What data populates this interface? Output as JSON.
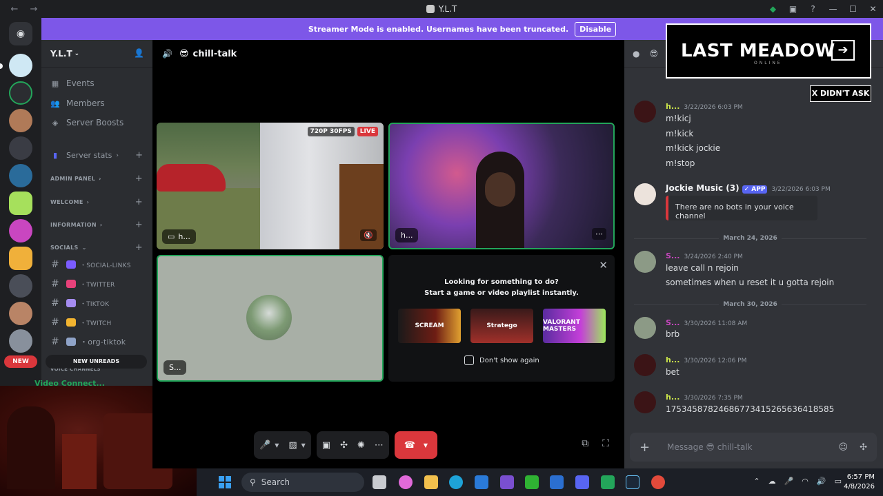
{
  "window": {
    "title": "Y.L.T",
    "back": "←",
    "forward": "→"
  },
  "banner": {
    "text": "Streamer Mode is enabled. Usernames have been truncated.",
    "disable_label": "Disable"
  },
  "server": {
    "name": "Y.L.T",
    "nav": [
      {
        "icon": "calendar-icon",
        "label": "Events"
      },
      {
        "icon": "members-icon",
        "label": "Members"
      },
      {
        "icon": "boost-icon",
        "label": "Server Boosts"
      }
    ],
    "server_stats": "Server stats",
    "categories": [
      {
        "label": "ADMIN PANEL"
      },
      {
        "label": "WELCOME"
      },
      {
        "label": "INFORMATION"
      },
      {
        "label": "SOCIALS"
      }
    ],
    "channels": [
      {
        "label": "・SOCIAL-LINKS",
        "color": "#7b5cff"
      },
      {
        "label": "・TWITTER",
        "color": "#e7417a"
      },
      {
        "label": "・TIKTOK",
        "color": "#a58cf0"
      },
      {
        "label": "・TWITCH",
        "color": "#f2b430"
      },
      {
        "label": "・org-tiktok",
        "color": "#8fa3c8"
      }
    ],
    "new_unreads": "NEW UNREADS",
    "voice_channels": "VOICE CHANNELS",
    "new_badge": "NEW",
    "video_connected": "Video Connect..."
  },
  "stage": {
    "channel_name": "chill-talk",
    "channel_emoji": "😎",
    "tiles": [
      {
        "label": "h...",
        "quality": "720P 30FPS",
        "live": "LIVE"
      },
      {
        "label": "h..."
      },
      {
        "label": "S..."
      }
    ],
    "activity": {
      "title": "Looking for something to do?",
      "subtitle": "Start a game or video playlist instantly.",
      "games": [
        "SCREAM",
        "Stratego",
        "VALORANT MASTERS"
      ],
      "dont_show": "Don't show again"
    }
  },
  "overlay": {
    "logo": "LAST MEADOW",
    "logo_sub": "ONLINE",
    "arrow": "➔",
    "didnt_ask": "X DIDN'T ASK"
  },
  "chat": {
    "messages": [
      {
        "author": "h...",
        "time": "3/22/2026 6:03 PM",
        "lines": [
          "m!kicj",
          "m!kick",
          "m!kick jockie",
          "m!stop"
        ]
      },
      {
        "author": "Jockie Music (3)",
        "tag": "✓ APP",
        "time": "3/22/2026 6:03 PM",
        "embed": "There are no bots in your voice channel"
      },
      {
        "divider": "March 24, 2026"
      },
      {
        "author": "S...",
        "time": "3/24/2026 2:40 PM",
        "lines": [
          "leave call n rejoin",
          "sometimes when u reset it u gotta rejoin"
        ]
      },
      {
        "divider": "March 30, 2026"
      },
      {
        "author": "S...",
        "time": "3/30/2026 11:08 AM",
        "lines": [
          "brb"
        ]
      },
      {
        "author": "h...",
        "time": "3/30/2026 12:06 PM",
        "lines": [
          "bet"
        ]
      },
      {
        "author": "h...",
        "time": "3/30/2026 7:35 PM",
        "lines": [
          "17534587824686773415265636418585"
        ]
      }
    ],
    "composer_placeholder": "Message 😎 chill-talk"
  },
  "taskbar": {
    "search": "Search",
    "time": "6:57 PM",
    "date": "4/8/2026"
  }
}
